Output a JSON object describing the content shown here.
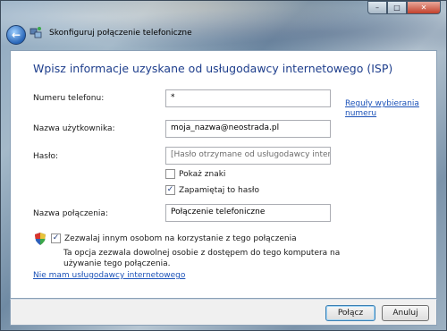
{
  "window": {
    "title": "Skonfiguruj połączenie telefoniczne",
    "caption": {
      "minimize": "–",
      "maximize": "□",
      "close": "✕"
    },
    "back": "←"
  },
  "main": {
    "heading": "Wpisz informacje uzyskane od usługodawcy internetowego (ISP)",
    "fields": {
      "phone_label": "Numeru telefonu:",
      "phone_value": "*",
      "dialing_rules_link": "Reguły wybierania numeru",
      "username_label": "Nazwa użytkownika:",
      "username_value": "moja_nazwa@neostrada.pl",
      "password_label": "Hasło:",
      "password_placeholder": "[Hasło otrzymane od usługodawcy interne",
      "show_chars_label": "Pokaż znaki",
      "show_chars_checked": false,
      "remember_label": "Zapamiętaj to hasło",
      "remember_checked": true,
      "connection_name_label": "Nazwa połączenia:",
      "connection_name_value": "Połączenie telefoniczne"
    },
    "allow_others": {
      "label": "Zezwalaj innym osobom na korzystanie z tego połączenia",
      "checked": true,
      "description": "Ta opcja zezwala dowolnej osobie z dostępem do tego komputera na używanie tego połączenia."
    },
    "no_isp_link": "Nie mam usługodawcy internetowego"
  },
  "footer": {
    "connect_label": "Połącz",
    "cancel_label": "Anuluj"
  },
  "colors": {
    "heading": "#1e3e8c",
    "link": "#1c52b8"
  }
}
